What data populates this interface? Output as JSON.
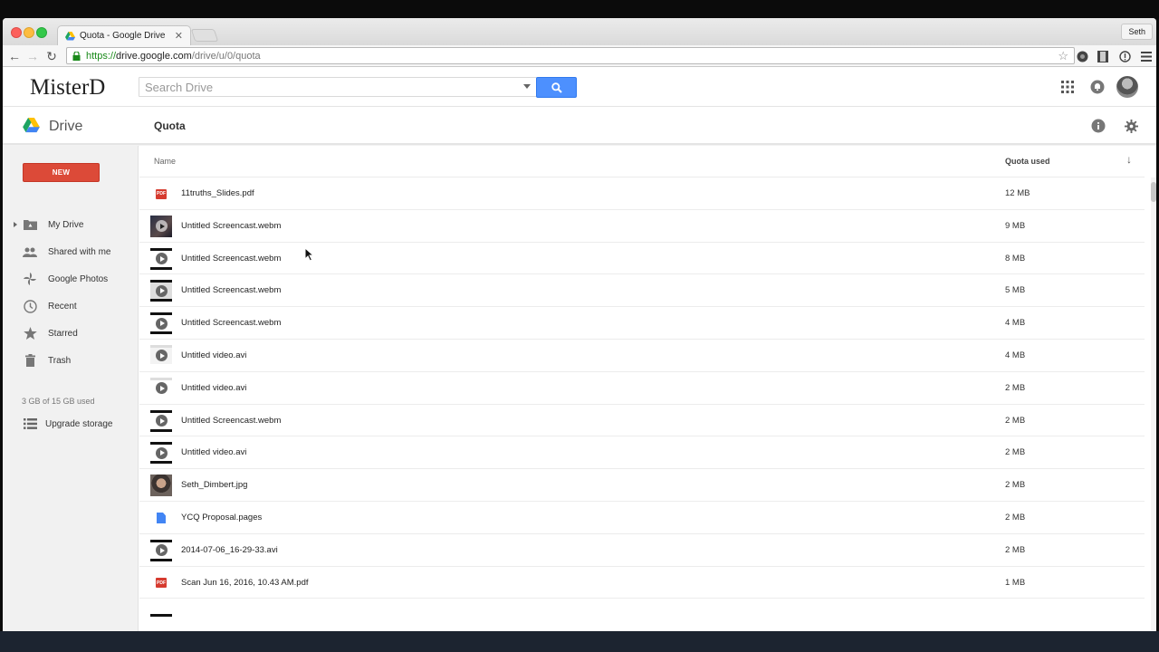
{
  "browser": {
    "tab_title": "Quota - Google Drive",
    "profile_name": "Seth",
    "url_scheme": "https://",
    "url_host": "drive.google.com",
    "url_path": "/drive/u/0/quota"
  },
  "header": {
    "brand": "MisterD",
    "search_placeholder": "Search Drive"
  },
  "subheader": {
    "app_name": "Drive",
    "page_title": "Quota"
  },
  "sidebar": {
    "new_label": "NEW",
    "items": [
      {
        "label": "My Drive",
        "icon": "folder-drive-icon"
      },
      {
        "label": "Shared with me",
        "icon": "people-icon"
      },
      {
        "label": "Google Photos",
        "icon": "pinwheel-icon"
      },
      {
        "label": "Recent",
        "icon": "clock-icon"
      },
      {
        "label": "Starred",
        "icon": "star-icon"
      },
      {
        "label": "Trash",
        "icon": "trash-icon"
      }
    ],
    "quota_text": "3 GB of 15 GB used",
    "upgrade_label": "Upgrade storage"
  },
  "table": {
    "col_name": "Name",
    "col_quota": "Quota used",
    "sort_indicator": "↓",
    "rows": [
      {
        "name": "11truths_Slides.pdf",
        "size": "12 MB",
        "icon": "pdf-icon"
      },
      {
        "name": "Untitled Screencast.webm",
        "size": "9 MB",
        "icon": "video-thumbnail-icon"
      },
      {
        "name": "Untitled Screencast.webm",
        "size": "8 MB",
        "icon": "video-file-icon"
      },
      {
        "name": "Untitled Screencast.webm",
        "size": "5 MB",
        "icon": "video-file-icon"
      },
      {
        "name": "Untitled Screencast.webm",
        "size": "4 MB",
        "icon": "video-file-icon"
      },
      {
        "name": "Untitled video.avi",
        "size": "4 MB",
        "icon": "video-file-icon"
      },
      {
        "name": "Untitled video.avi",
        "size": "2 MB",
        "icon": "video-file-icon"
      },
      {
        "name": "Untitled Screencast.webm",
        "size": "2 MB",
        "icon": "video-file-icon"
      },
      {
        "name": "Untitled video.avi",
        "size": "2 MB",
        "icon": "video-file-icon"
      },
      {
        "name": "Seth_Dimbert.jpg",
        "size": "2 MB",
        "icon": "photo-thumbnail-icon"
      },
      {
        "name": "YCQ Proposal.pages",
        "size": "2 MB",
        "icon": "document-icon"
      },
      {
        "name": "2014-07-06_16-29-33.avi",
        "size": "2 MB",
        "icon": "video-file-icon"
      },
      {
        "name": "Scan Jun 16, 2016, 10.43 AM.pdf",
        "size": "1 MB",
        "icon": "pdf-icon"
      }
    ]
  },
  "colors": {
    "new_button": "#dc4a38",
    "search_button": "#4d90fe",
    "pdf_badge": "#d63b2f",
    "doc_blue": "#4285f4"
  }
}
